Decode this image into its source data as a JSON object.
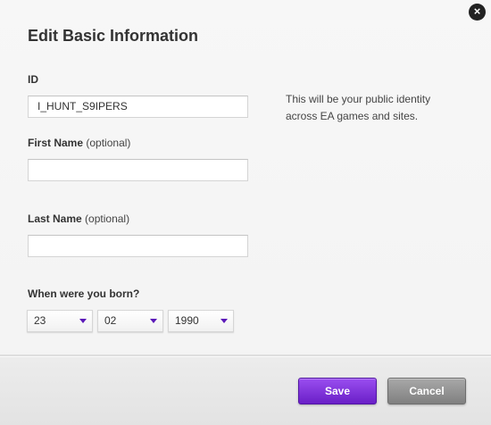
{
  "dialog": {
    "title": "Edit Basic Information",
    "close_symbol": "×"
  },
  "form": {
    "id": {
      "label": "ID",
      "value": "I_HUNT_S9IPERS",
      "hint": "This will be your public identity across EA games and sites."
    },
    "first_name": {
      "label": "First Name",
      "optional": "(optional)",
      "value": ""
    },
    "last_name": {
      "label": "Last Name",
      "optional": "(optional)",
      "value": ""
    },
    "birth": {
      "label": "When were you born?",
      "day": "23",
      "month": "02",
      "year": "1990"
    }
  },
  "buttons": {
    "save": "Save",
    "cancel": "Cancel"
  },
  "colors": {
    "accent": "#6a1fc7",
    "caret": "#5a18b8",
    "cancel": "#8c8c8c"
  },
  "icons": {
    "close": "close-icon",
    "dropdown": "chevron-down-icon"
  }
}
